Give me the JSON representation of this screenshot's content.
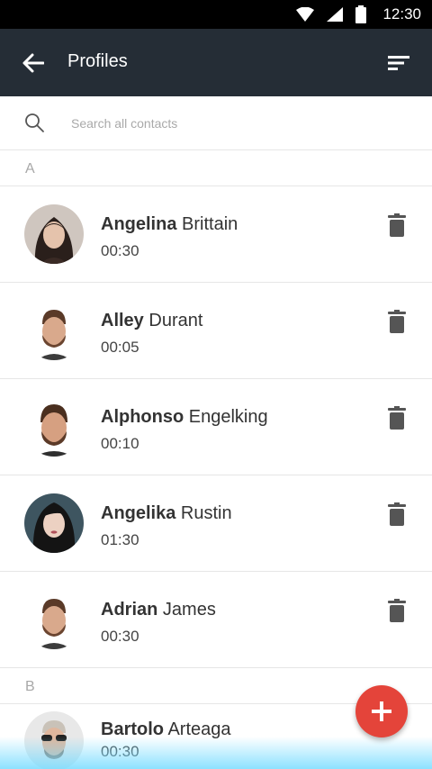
{
  "status_bar": {
    "time": "12:30",
    "icons": [
      "wifi-icon",
      "signal-icon",
      "battery-icon"
    ]
  },
  "app_bar": {
    "title": "Profiles",
    "back_icon": "arrow-left-icon",
    "sort_icon": "sort-icon",
    "background": "#252d36"
  },
  "search": {
    "placeholder": "Search all contacts",
    "value": "",
    "icon": "search-icon"
  },
  "sections": [
    {
      "letter": "A"
    },
    {
      "letter": "B"
    }
  ],
  "contacts": [
    {
      "first": "Angelina",
      "last": "Brittain",
      "duration": "00:30"
    },
    {
      "first": "Alley",
      "last": "Durant",
      "duration": "00:05"
    },
    {
      "first": "Alphonso",
      "last": "Engelking",
      "duration": "00:10"
    },
    {
      "first": "Angelika",
      "last": "Rustin",
      "duration": "01:30"
    },
    {
      "first": "Adrian",
      "last": "James",
      "duration": "00:30"
    },
    {
      "first": "Bartolo",
      "last": "Arteaga",
      "duration": "00:30"
    }
  ],
  "fab": {
    "icon": "plus-icon",
    "color": "#e4443a"
  },
  "colors": {
    "accent": "#e4443a",
    "divider": "#e6e6e6",
    "delete_icon": "#555555"
  }
}
